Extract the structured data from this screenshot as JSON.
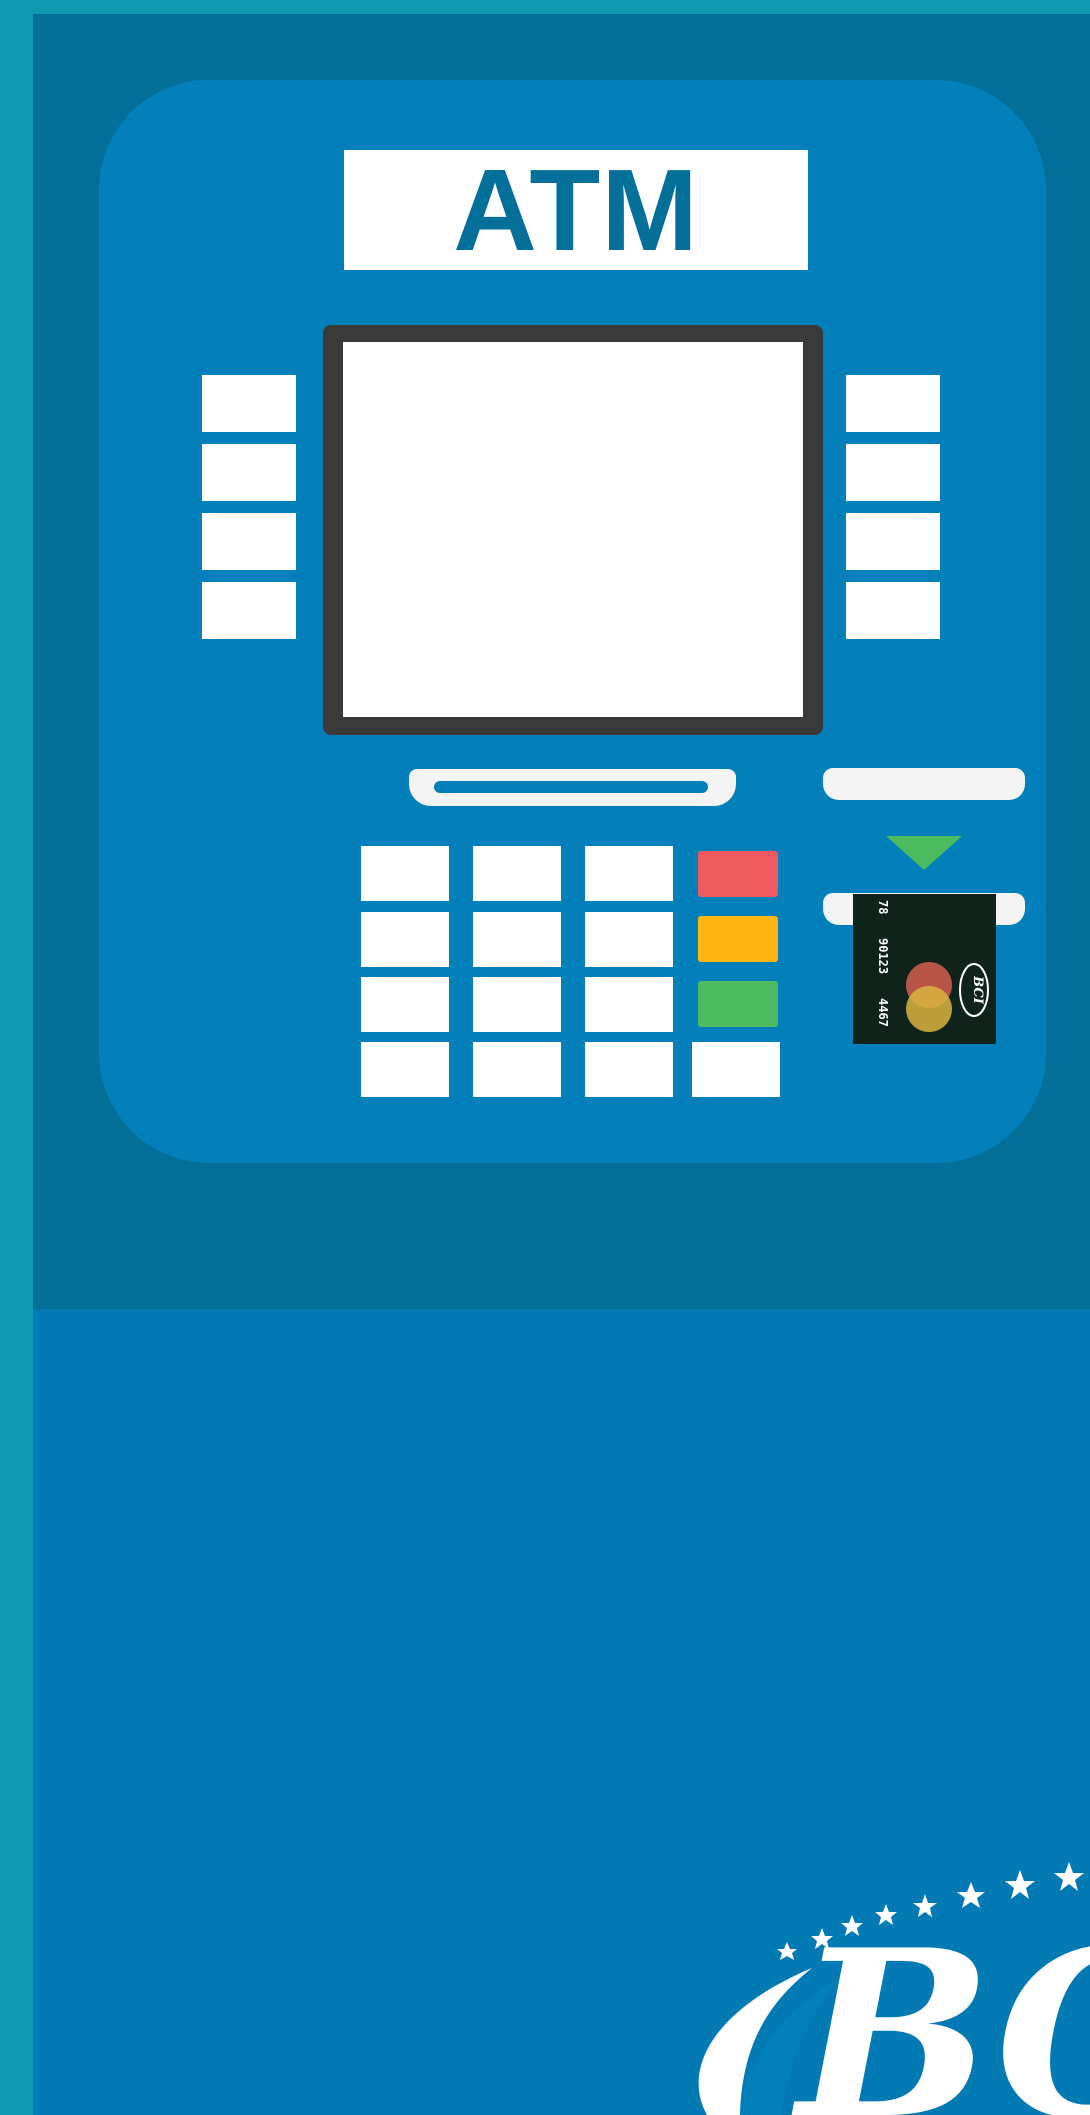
{
  "atm": {
    "sign_label": "ATM",
    "colors": {
      "frame": "#046f99",
      "panel": "#0380ba",
      "lower_body": "#047ab5",
      "outer_background": "#0e9bb1",
      "cancel_key": "#ef5a5f",
      "clear_key": "#fdb614",
      "enter_key": "#4dba5e",
      "arrow": "#4dba5e"
    },
    "side_buttons": {
      "left": [
        {
          "name": "side-button-left-1"
        },
        {
          "name": "side-button-left-2"
        },
        {
          "name": "side-button-left-3"
        },
        {
          "name": "side-button-left-4"
        }
      ],
      "right": [
        {
          "name": "side-button-right-1"
        },
        {
          "name": "side-button-right-2"
        },
        {
          "name": "side-button-right-3"
        },
        {
          "name": "side-button-right-4"
        }
      ]
    },
    "keypad": {
      "rows": 4,
      "columns": 3,
      "function_keys": [
        {
          "name": "cancel-key",
          "color": "#ef5a5f"
        },
        {
          "name": "clear-key",
          "color": "#fdb614"
        },
        {
          "name": "enter-key",
          "color": "#4dba5e"
        },
        {
          "name": "blank-key",
          "color": "#ffffff"
        }
      ]
    },
    "card": {
      "number_parts": [
        "78",
        "90123",
        "4467"
      ],
      "brand": "BCI",
      "network_icon": "mastercard-logo-icon"
    }
  },
  "logo": {
    "text": "BCI",
    "icon": "bci-bank-logo"
  }
}
